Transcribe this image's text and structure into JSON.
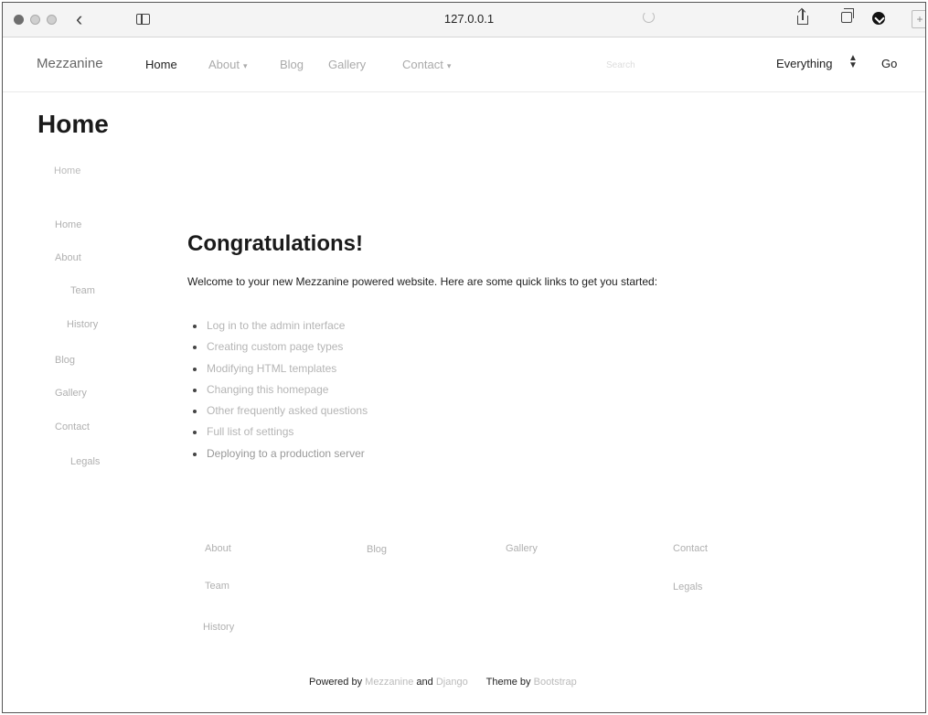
{
  "browser": {
    "address": "127.0.0.1"
  },
  "navbar": {
    "brand": "Mezzanine",
    "items": [
      {
        "label": "Home"
      },
      {
        "label": "About"
      },
      {
        "label": "Blog"
      },
      {
        "label": "Gallery"
      },
      {
        "label": "Contact"
      }
    ],
    "search_placeholder": "Search",
    "search_scope": "Everything",
    "go_label": "Go"
  },
  "page": {
    "title": "Home",
    "breadcrumb": "Home"
  },
  "side_nav": {
    "items": [
      {
        "label": "Home"
      },
      {
        "label": "About"
      },
      {
        "label": "Team"
      },
      {
        "label": "History"
      },
      {
        "label": "Blog"
      },
      {
        "label": "Gallery"
      },
      {
        "label": "Contact"
      },
      {
        "label": "Legals"
      }
    ]
  },
  "main": {
    "heading": "Congratulations!",
    "intro": "Welcome to your new Mezzanine powered website. Here are some quick links to get you started:",
    "links": [
      "Log in to the admin interface",
      "Creating custom page types",
      "Modifying HTML templates",
      "Changing this homepage",
      "Other frequently asked questions",
      "Full list of settings",
      "Deploying to a production server"
    ]
  },
  "footer": {
    "columns": [
      {
        "label": "About",
        "children": [
          "Team",
          "History"
        ]
      },
      {
        "label": "Blog",
        "children": []
      },
      {
        "label": "Gallery",
        "children": []
      },
      {
        "label": "Contact",
        "children": [
          "Legals"
        ]
      }
    ],
    "powered_by": "Powered by",
    "mezzanine": "Mezzanine",
    "and": "and",
    "django": "Django",
    "theme_by": "Theme by",
    "bootstrap": "Bootstrap"
  }
}
